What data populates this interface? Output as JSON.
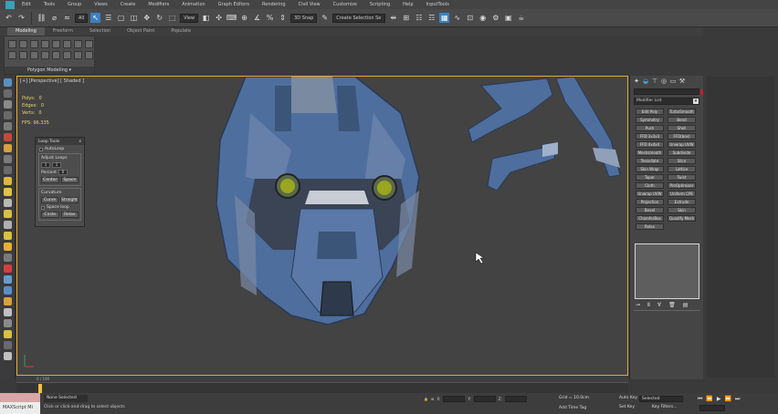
{
  "menu": {
    "items": [
      "Edit",
      "Tools",
      "Group",
      "Views",
      "Create",
      "Modifiers",
      "Animation",
      "Graph Editors",
      "Rendering",
      "Civil View",
      "Customize",
      "Scripting",
      "Help",
      "InputTools"
    ]
  },
  "toolbar": {
    "all_dropdown": "All",
    "view_dropdown": "View",
    "snaps_value": "3D Snap",
    "selection_set_placeholder": "Create Selection Se"
  },
  "ribbon": {
    "tabs": [
      "Modeling",
      "Freeform",
      "Selection",
      "Object Paint",
      "Populate"
    ],
    "active_tab": "Modeling",
    "panel_label": "Polygon Modeling ▾"
  },
  "viewport": {
    "label": "[+] [Perspective] [ Shaded ]",
    "stats": [
      {
        "label": "Polys:",
        "value": "0"
      },
      {
        "label": "Edges:",
        "value": "0"
      },
      {
        "label": "Verts:",
        "value": "0"
      }
    ],
    "fps_label": "FPS:",
    "fps_value": "96.335",
    "border_color": "#e0a93a",
    "model_color": "#4e6e9e",
    "eye_color": "#9aa61e"
  },
  "loop_tools": {
    "title": "Loop Tools",
    "close": "x",
    "autoloop": "AutoLoop",
    "adjust_loops": "Adjust Loops",
    "spin_a": "1",
    "spin_b": "1",
    "percent": "Percent",
    "percent_val": "0",
    "center": "Center",
    "space": "Space",
    "curvature": "Curvature",
    "curve": "Curve",
    "straight": "Straight",
    "space_loop": "Space loop",
    "circle": "Circle",
    "relax": "Relax"
  },
  "command_panel": {
    "tabs": [
      "create-icon",
      "modify-icon",
      "hierarchy-icon",
      "motion-icon",
      "display-icon",
      "utilities-icon"
    ],
    "modifier_list": "Modifier List",
    "modifiers": [
      "Edit Poly",
      "TurboSmooth",
      "Symmetry",
      "Bend",
      "Push",
      "Shell",
      "FFD 3x3x3",
      "FFD(box)",
      "FFD 4x4x4",
      "Unwrap UVW",
      "Meshsmooth",
      "Subdivide",
      "Tessellate",
      "Slice",
      "Skin Wrap",
      "Lattice",
      "Taper",
      "Twist",
      "Cloth",
      "ProOptimizer",
      "Unwrap UVW",
      "Uniform CPE",
      "Projection",
      "Extrude",
      "Bevel",
      "Skin",
      "ChamferBox",
      "Quadify Mesh",
      "Relax",
      ""
    ],
    "name_color": "#c41e2a"
  },
  "timeline": {
    "frame_label": "0 / 100"
  },
  "status": {
    "maxscript": "MAXScript Mi",
    "selection": "None Selected",
    "prompt": "Click or click-and-drag to select objects",
    "grid": "Grid = 10.0cm",
    "add_time_tag": "Add Time Tag",
    "auto_key": "Auto Key",
    "selected": "Selected",
    "set_key": "Set Key",
    "key_filters": "Key Filters...",
    "frame": "0"
  }
}
